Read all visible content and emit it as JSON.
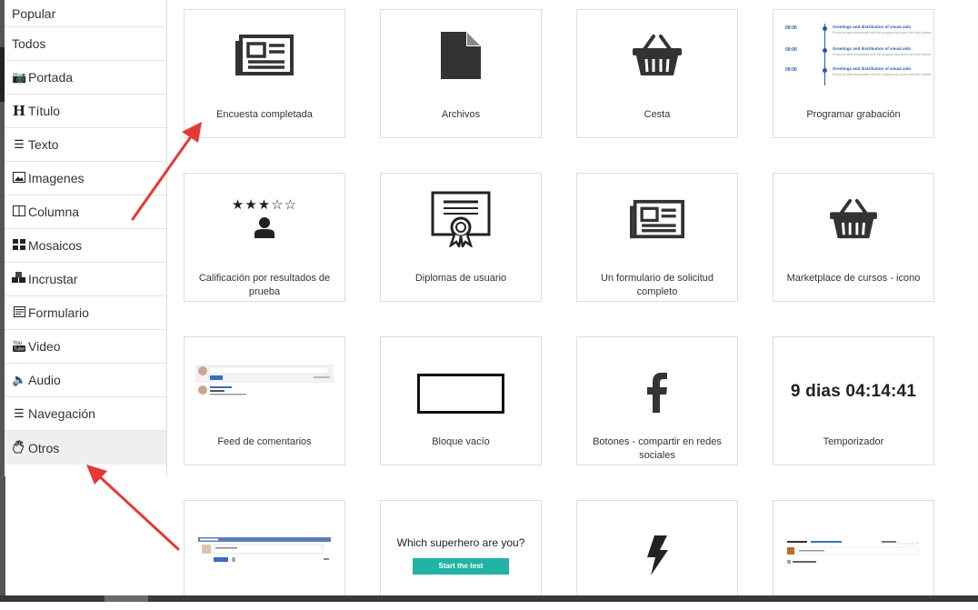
{
  "sidebar": {
    "items": [
      {
        "label": "Popular",
        "icon": ""
      },
      {
        "label": "Todos",
        "icon": ""
      },
      {
        "label": "Portada",
        "icon": "camera-icon"
      },
      {
        "label": "Título",
        "icon": "heading-icon"
      },
      {
        "label": "Texto",
        "icon": "text-lines-icon"
      },
      {
        "label": "Imagenes",
        "icon": "image-icon"
      },
      {
        "label": "Columna",
        "icon": "columns-icon"
      },
      {
        "label": "Mosaicos",
        "icon": "tiles-icon"
      },
      {
        "label": "Incrustar",
        "icon": "cubes-icon"
      },
      {
        "label": "Formulario",
        "icon": "form-icon"
      },
      {
        "label": "Video",
        "icon": "youtube-icon"
      },
      {
        "label": "Audio",
        "icon": "speaker-icon"
      },
      {
        "label": "Navegación",
        "icon": "menu-icon"
      },
      {
        "label": "Otros",
        "icon": "hand-icon"
      }
    ],
    "active": "Otros"
  },
  "cards": {
    "survey": {
      "label": "Encuesta completada",
      "icon": "newspaper-icon"
    },
    "files": {
      "label": "Archivos",
      "icon": "file-icon"
    },
    "basket": {
      "label": "Cesta",
      "icon": "basket-icon"
    },
    "schedule": {
      "label": "Programar grabación",
      "time": "09:00",
      "heading": "Greetings and distribution of visual aids",
      "detail": "Everyone gets acquainted with the program and goes into their places"
    },
    "rating": {
      "label": "Calificación por resultados de prueba",
      "stars": "★★★☆☆",
      "icon": "user-icon"
    },
    "diplomas": {
      "label": "Diplomas de usuario",
      "icon": "certificate-icon"
    },
    "fullform": {
      "label": "Un formulario de solicitud completo",
      "icon": "newspaper-icon"
    },
    "marketplace": {
      "label": "Marketplace de cursos - icono",
      "icon": "basket-icon"
    },
    "comments": {
      "label": "Feed de comentarios",
      "icon": "comment-feed-preview"
    },
    "empty": {
      "label": "Bloque vacío",
      "icon": "empty-rectangle"
    },
    "share": {
      "label": "Botones - compartir en redes sociales",
      "icon": "facebook-icon"
    },
    "timer": {
      "label": "Temporizador",
      "value": "9 dias 04:14:41"
    },
    "row4a": {
      "icon": "comment-form-preview"
    },
    "quiz": {
      "title": "Which superhero are you?",
      "button": "Start the test"
    },
    "lightning": {
      "icon": "lightning-icon"
    },
    "row4d": {
      "icon": "discussion-preview"
    }
  },
  "colors": {
    "arrow": "#e53935",
    "accent": "#21b3a6",
    "timeline": "#2c56b0"
  }
}
